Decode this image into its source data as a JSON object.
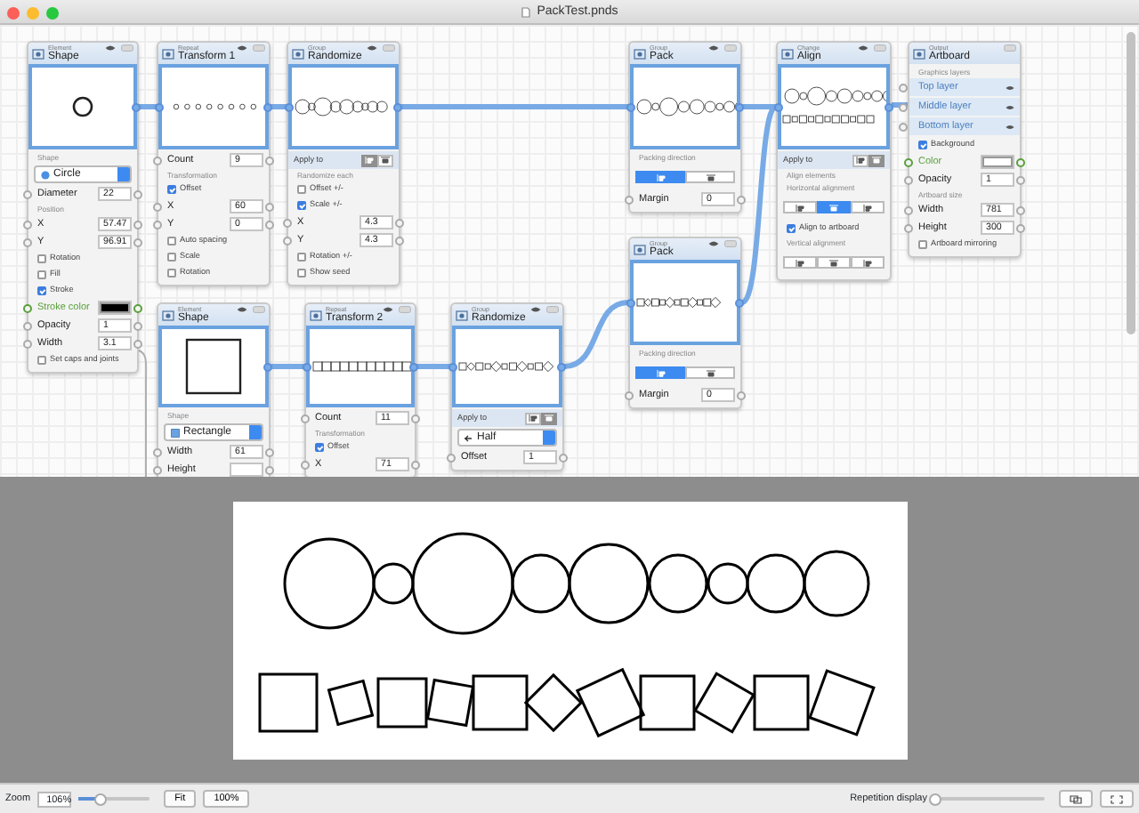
{
  "window": {
    "title": "PackTest.pnds"
  },
  "nodes": [
    {
      "kind": "circle",
      "category": "Element",
      "title": "Shape",
      "rows": [
        {
          "kind": "section",
          "label": "Shape"
        },
        {
          "kind": "dropdown",
          "value": "Circle"
        },
        {
          "kind": "field",
          "label": "Diameter",
          "value": "22"
        },
        {
          "kind": "section",
          "label": "Position"
        },
        {
          "kind": "field",
          "label": "X",
          "value": "57.47"
        },
        {
          "kind": "field",
          "label": "Y",
          "value": "96.91"
        },
        {
          "kind": "check",
          "label": "Rotation",
          "checked": false
        },
        {
          "kind": "check",
          "label": "Fill",
          "checked": false
        },
        {
          "kind": "check",
          "label": "Stroke",
          "checked": true
        },
        {
          "kind": "color",
          "label": "Stroke color",
          "color": "#000000"
        },
        {
          "kind": "field",
          "label": "Opacity",
          "value": "1"
        },
        {
          "kind": "field",
          "label": "Width",
          "value": "3.1"
        },
        {
          "kind": "check",
          "label": "Set caps and joints",
          "checked": false
        }
      ]
    },
    {
      "kind": "circle-row",
      "category": "Repeat",
      "title": "Transform 1",
      "rows": [
        {
          "kind": "field",
          "label": "Count",
          "value": "9"
        },
        {
          "kind": "section",
          "label": "Transformation"
        },
        {
          "kind": "check",
          "label": "Offset",
          "checked": true
        },
        {
          "kind": "field",
          "label": "X",
          "value": "60"
        },
        {
          "kind": "field",
          "label": "Y",
          "value": "0"
        },
        {
          "kind": "check",
          "label": "Auto spacing",
          "checked": false
        },
        {
          "kind": "check",
          "label": "Scale",
          "checked": false
        },
        {
          "kind": "check",
          "label": "Rotation",
          "checked": false
        }
      ]
    },
    {
      "kind": "circle-random",
      "category": "Group",
      "title": "Randomize",
      "rows": [
        {
          "kind": "apply",
          "label": "Apply to",
          "segments": [
            {
              "selected": true
            },
            {
              "selected": false
            }
          ]
        },
        {
          "kind": "section",
          "label": "Randomize each"
        },
        {
          "kind": "check",
          "label": "Offset +/-",
          "checked": false
        },
        {
          "kind": "check",
          "label": "Scale +/-",
          "checked": true
        },
        {
          "kind": "field",
          "label": "X",
          "value": "4.3"
        },
        {
          "kind": "field",
          "label": "Y",
          "value": "4.3"
        },
        {
          "kind": "check",
          "label": "Rotation +/-",
          "checked": false
        },
        {
          "kind": "check",
          "label": "Show seed",
          "checked": false
        }
      ]
    },
    {
      "kind": "circle-packed",
      "category": "Group",
      "title": "Pack",
      "rows": [
        {
          "kind": "section",
          "label": "Packing direction"
        },
        {
          "kind": "segmented",
          "segments": [
            {
              "selected": true
            },
            {
              "selected": false
            }
          ]
        },
        {
          "kind": "field",
          "label": "Margin",
          "value": "0"
        }
      ]
    },
    {
      "kind": "aligned",
      "category": "Change",
      "title": "Align",
      "rows": [
        {
          "kind": "apply",
          "label": "Apply to",
          "segments": [
            {
              "selected": false
            },
            {
              "selected": true
            }
          ]
        },
        {
          "kind": "section",
          "label": "Align elements"
        },
        {
          "kind": "section",
          "label": "Horizontal alignment"
        },
        {
          "kind": "segmented",
          "segments": [
            {
              "selected": false
            },
            {
              "selected": true
            },
            {
              "selected": false
            }
          ]
        },
        {
          "kind": "check",
          "label": "Align to artboard",
          "checked": true
        },
        {
          "kind": "section",
          "label": "Vertical alignment"
        },
        {
          "kind": "segmented",
          "segments": [
            {
              "selected": false
            },
            {
              "selected": false
            },
            {
              "selected": false
            }
          ]
        }
      ]
    },
    {
      "kind": "artboard",
      "category": "Output",
      "title": "Artboard",
      "rows": [
        {
          "kind": "section",
          "label": "Graphics layers"
        },
        {
          "kind": "layer",
          "label": "Top layer"
        },
        {
          "kind": "layer",
          "label": "Middle layer"
        },
        {
          "kind": "layer",
          "label": "Bottom layer"
        },
        {
          "kind": "check",
          "label": "Background",
          "checked": true
        },
        {
          "kind": "color",
          "label": "Color",
          "color": "#ffffff"
        },
        {
          "kind": "field",
          "label": "Opacity",
          "value": "1"
        },
        {
          "kind": "section",
          "label": "Artboard size"
        },
        {
          "kind": "field",
          "label": "Width",
          "value": "781"
        },
        {
          "kind": "field",
          "label": "Height",
          "value": "300"
        },
        {
          "kind": "check",
          "label": "Artboard mirroring",
          "checked": false
        }
      ]
    },
    {
      "kind": "square-packed",
      "category": "Group",
      "title": "Pack",
      "rows": [
        {
          "kind": "section",
          "label": "Packing direction"
        },
        {
          "kind": "segmented",
          "segments": [
            {
              "selected": true
            },
            {
              "selected": false
            }
          ]
        },
        {
          "kind": "field",
          "label": "Margin",
          "value": "0"
        }
      ]
    },
    {
      "kind": "square",
      "category": "Element",
      "title": "Shape",
      "rows": [
        {
          "kind": "section",
          "label": "Shape"
        },
        {
          "kind": "dropdown",
          "value": "Rectangle"
        },
        {
          "kind": "field",
          "label": "Width",
          "value": "61"
        },
        {
          "kind": "field",
          "label": "Height"
        }
      ]
    },
    {
      "kind": "square-row",
      "category": "Repeat",
      "title": "Transform 2",
      "rows": [
        {
          "kind": "field",
          "label": "Count",
          "value": "11"
        },
        {
          "kind": "section",
          "label": "Transformation"
        },
        {
          "kind": "check",
          "label": "Offset",
          "checked": true
        },
        {
          "kind": "field",
          "label": "X",
          "value": "71"
        }
      ]
    },
    {
      "kind": "square-random",
      "category": "Group",
      "title": "Randomize",
      "rows": [
        {
          "kind": "apply",
          "label": "Apply to",
          "segments": [
            {
              "selected": false
            },
            {
              "selected": true
            }
          ]
        },
        {
          "kind": "dropdown",
          "value": "Half"
        },
        {
          "kind": "field",
          "label": "Offset",
          "value": "1"
        }
      ]
    }
  ],
  "status_bar": {
    "zoom_label": "Zoom",
    "zoom_value": "106%",
    "zoom_slider": {
      "level": 0.3
    },
    "fit_button": "Fit",
    "actual_size_button": "100%",
    "repetition_label": "Repetition display",
    "repetition_slider": {
      "level": 0
    }
  }
}
